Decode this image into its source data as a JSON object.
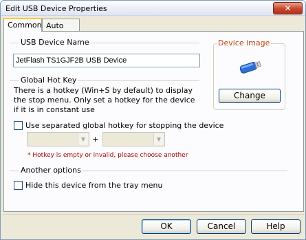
{
  "window": {
    "title": "Edit USB Device Properties",
    "close_glyph": "✕"
  },
  "tabs": [
    {
      "label": "Common",
      "active": true
    },
    {
      "label": "Auto Run",
      "active": false
    }
  ],
  "device_name": {
    "group_label": "USB Device Name",
    "value": "JetFlash TS1GJF2B USB Device"
  },
  "device_image": {
    "group_label": "Device image",
    "icon": "usb-drive-icon",
    "change_label": "Change"
  },
  "hotkey": {
    "group_label": "Global Hot Key",
    "description": "There is a hotkey (Win+S by default) to display the stop menu. Only set a hotkey for the device if it is in constant use",
    "checkbox_label": "Use separated global hotkey for stopping the device",
    "checked": false,
    "combo1_value": "",
    "combo2_value": "",
    "plus_sign": "+",
    "error": "* Hotkey is empty or invalid, please choose another"
  },
  "other": {
    "group_label": "Another options",
    "hide_label": "Hide this device from the tray menu",
    "checked": false
  },
  "buttons": {
    "ok": "OK",
    "cancel": "Cancel",
    "help": "Help"
  },
  "colors": {
    "image_group_label": "#c04000",
    "error_text": "#a00000",
    "button_border": "#003c74"
  }
}
